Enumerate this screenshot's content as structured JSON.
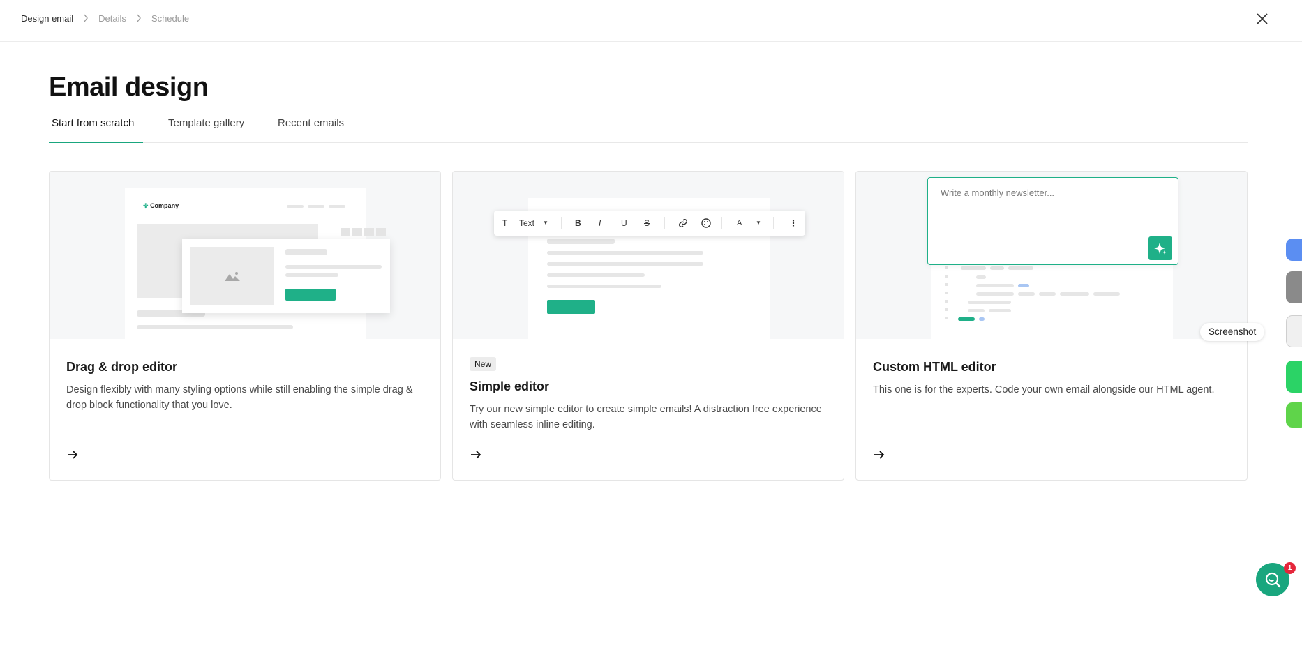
{
  "breadcrumb": {
    "items": [
      {
        "label": "Design email"
      },
      {
        "label": "Details"
      },
      {
        "label": "Schedule"
      }
    ]
  },
  "page": {
    "title": "Email design"
  },
  "tabs": [
    {
      "label": "Start from scratch",
      "active": true
    },
    {
      "label": "Template gallery",
      "active": false
    },
    {
      "label": "Recent emails",
      "active": false
    }
  ],
  "cards": [
    {
      "title": "Drag & drop editor",
      "description": "Design flexibly with many styling options while still enabling the simple drag & drop block functionality that you love.",
      "preview": {
        "logo_text": "Company"
      }
    },
    {
      "badge": "New",
      "title": "Simple editor",
      "description": "Try our new simple editor to create simple emails! A distraction free experience with seamless inline editing.",
      "preview": {
        "toolbar_text_style": "Text",
        "toolbar_font_letter": "A"
      }
    },
    {
      "title": "Custom HTML editor",
      "description": "This one is for the experts. Code your own email alongside our HTML agent.",
      "preview": {
        "prompt_placeholder": "Write a monthly newsletter..."
      }
    }
  ],
  "overlay": {
    "screenshot_tooltip": "Screenshot"
  },
  "help": {
    "notification_count": "1"
  },
  "colors": {
    "accent": "#19a67e",
    "badge_red": "#e5263b"
  }
}
